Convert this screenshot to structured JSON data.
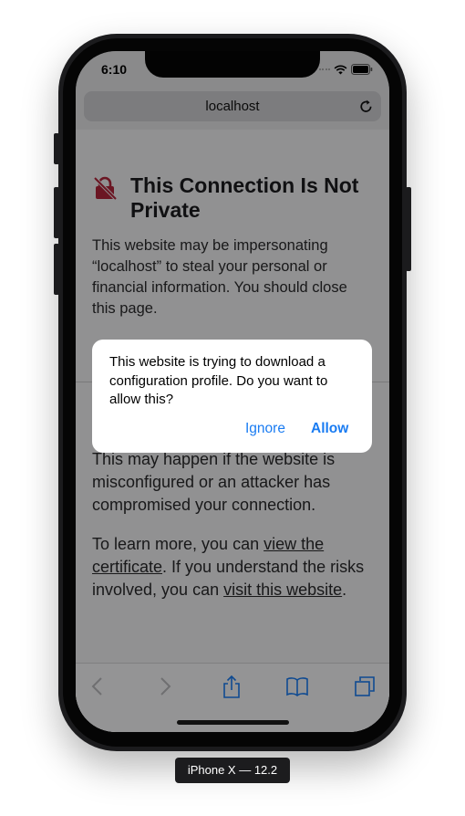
{
  "device": {
    "label": "iPhone X — 12.2"
  },
  "status_bar": {
    "time": "6:10"
  },
  "browser": {
    "url": "localhost"
  },
  "page": {
    "heading": "This Connection Is Not Private",
    "paragraph1": "This website may be impersonating “localhost” to steal your personal or financial information. You should close this page.",
    "paragraph2": "This may happen if the website is misconfigured or an attacker has compromised your connection.",
    "paragraph3_prefix": "To learn more, you can ",
    "view_certificate_link": "view the certificate",
    "paragraph3_middle": ". If you understand the risks involved, you can ",
    "visit_website_link": "visit this website",
    "paragraph3_suffix": "."
  },
  "alert": {
    "message": "This website is trying to download a configuration profile. Do you want to allow this?",
    "ignore_label": "Ignore",
    "allow_label": "Allow"
  },
  "colors": {
    "accent": "#1a7cf2",
    "warning_icon": "#b3263b"
  },
  "icons": {
    "status": [
      "wifi-icon",
      "battery-icon"
    ],
    "url_bar": "reload-icon",
    "page": "lock-slash-icon",
    "toolbar": [
      "back-icon",
      "forward-icon",
      "share-icon",
      "bookmarks-icon",
      "tabs-icon"
    ]
  }
}
